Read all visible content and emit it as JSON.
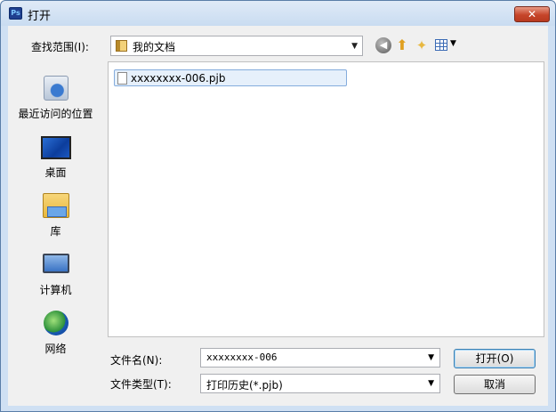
{
  "window": {
    "title": "打开",
    "app_icon_text": "Ps",
    "close_label": "✕"
  },
  "toolbar": {
    "lookin_label": "查找范围(I):",
    "lookin_value": "我的文档",
    "icons": [
      "back-icon",
      "up-folder-icon",
      "new-folder-icon",
      "view-menu-icon"
    ]
  },
  "places": [
    {
      "label": "最近访问的位置",
      "icon": "recent-places-icon"
    },
    {
      "label": "桌面",
      "icon": "desktop-icon"
    },
    {
      "label": "库",
      "icon": "libraries-icon"
    },
    {
      "label": "计算机",
      "icon": "computer-icon"
    },
    {
      "label": "网络",
      "icon": "network-icon"
    }
  ],
  "files": [
    {
      "name": "xxxxxxxx-006.pjb"
    }
  ],
  "filename": {
    "label": "文件名(N):",
    "value": "xxxxxxxx-006"
  },
  "filetype": {
    "label": "文件类型(T):",
    "value": "打印历史(*.pjb)"
  },
  "buttons": {
    "open": "打开(O)",
    "cancel": "取消"
  }
}
